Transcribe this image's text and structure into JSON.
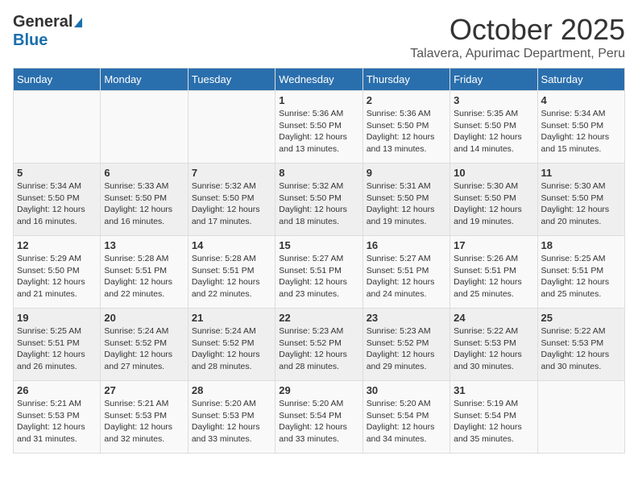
{
  "logo": {
    "general": "General",
    "blue": "Blue"
  },
  "header": {
    "month": "October 2025",
    "location": "Talavera, Apurimac Department, Peru"
  },
  "weekdays": [
    "Sunday",
    "Monday",
    "Tuesday",
    "Wednesday",
    "Thursday",
    "Friday",
    "Saturday"
  ],
  "weeks": [
    [
      {
        "day": "",
        "info": ""
      },
      {
        "day": "",
        "info": ""
      },
      {
        "day": "",
        "info": ""
      },
      {
        "day": "1",
        "info": "Sunrise: 5:36 AM\nSunset: 5:50 PM\nDaylight: 12 hours\nand 13 minutes."
      },
      {
        "day": "2",
        "info": "Sunrise: 5:36 AM\nSunset: 5:50 PM\nDaylight: 12 hours\nand 13 minutes."
      },
      {
        "day": "3",
        "info": "Sunrise: 5:35 AM\nSunset: 5:50 PM\nDaylight: 12 hours\nand 14 minutes."
      },
      {
        "day": "4",
        "info": "Sunrise: 5:34 AM\nSunset: 5:50 PM\nDaylight: 12 hours\nand 15 minutes."
      }
    ],
    [
      {
        "day": "5",
        "info": "Sunrise: 5:34 AM\nSunset: 5:50 PM\nDaylight: 12 hours\nand 16 minutes."
      },
      {
        "day": "6",
        "info": "Sunrise: 5:33 AM\nSunset: 5:50 PM\nDaylight: 12 hours\nand 16 minutes."
      },
      {
        "day": "7",
        "info": "Sunrise: 5:32 AM\nSunset: 5:50 PM\nDaylight: 12 hours\nand 17 minutes."
      },
      {
        "day": "8",
        "info": "Sunrise: 5:32 AM\nSunset: 5:50 PM\nDaylight: 12 hours\nand 18 minutes."
      },
      {
        "day": "9",
        "info": "Sunrise: 5:31 AM\nSunset: 5:50 PM\nDaylight: 12 hours\nand 19 minutes."
      },
      {
        "day": "10",
        "info": "Sunrise: 5:30 AM\nSunset: 5:50 PM\nDaylight: 12 hours\nand 19 minutes."
      },
      {
        "day": "11",
        "info": "Sunrise: 5:30 AM\nSunset: 5:50 PM\nDaylight: 12 hours\nand 20 minutes."
      }
    ],
    [
      {
        "day": "12",
        "info": "Sunrise: 5:29 AM\nSunset: 5:50 PM\nDaylight: 12 hours\nand 21 minutes."
      },
      {
        "day": "13",
        "info": "Sunrise: 5:28 AM\nSunset: 5:51 PM\nDaylight: 12 hours\nand 22 minutes."
      },
      {
        "day": "14",
        "info": "Sunrise: 5:28 AM\nSunset: 5:51 PM\nDaylight: 12 hours\nand 22 minutes."
      },
      {
        "day": "15",
        "info": "Sunrise: 5:27 AM\nSunset: 5:51 PM\nDaylight: 12 hours\nand 23 minutes."
      },
      {
        "day": "16",
        "info": "Sunrise: 5:27 AM\nSunset: 5:51 PM\nDaylight: 12 hours\nand 24 minutes."
      },
      {
        "day": "17",
        "info": "Sunrise: 5:26 AM\nSunset: 5:51 PM\nDaylight: 12 hours\nand 25 minutes."
      },
      {
        "day": "18",
        "info": "Sunrise: 5:25 AM\nSunset: 5:51 PM\nDaylight: 12 hours\nand 25 minutes."
      }
    ],
    [
      {
        "day": "19",
        "info": "Sunrise: 5:25 AM\nSunset: 5:51 PM\nDaylight: 12 hours\nand 26 minutes."
      },
      {
        "day": "20",
        "info": "Sunrise: 5:24 AM\nSunset: 5:52 PM\nDaylight: 12 hours\nand 27 minutes."
      },
      {
        "day": "21",
        "info": "Sunrise: 5:24 AM\nSunset: 5:52 PM\nDaylight: 12 hours\nand 28 minutes."
      },
      {
        "day": "22",
        "info": "Sunrise: 5:23 AM\nSunset: 5:52 PM\nDaylight: 12 hours\nand 28 minutes."
      },
      {
        "day": "23",
        "info": "Sunrise: 5:23 AM\nSunset: 5:52 PM\nDaylight: 12 hours\nand 29 minutes."
      },
      {
        "day": "24",
        "info": "Sunrise: 5:22 AM\nSunset: 5:53 PM\nDaylight: 12 hours\nand 30 minutes."
      },
      {
        "day": "25",
        "info": "Sunrise: 5:22 AM\nSunset: 5:53 PM\nDaylight: 12 hours\nand 30 minutes."
      }
    ],
    [
      {
        "day": "26",
        "info": "Sunrise: 5:21 AM\nSunset: 5:53 PM\nDaylight: 12 hours\nand 31 minutes."
      },
      {
        "day": "27",
        "info": "Sunrise: 5:21 AM\nSunset: 5:53 PM\nDaylight: 12 hours\nand 32 minutes."
      },
      {
        "day": "28",
        "info": "Sunrise: 5:20 AM\nSunset: 5:53 PM\nDaylight: 12 hours\nand 33 minutes."
      },
      {
        "day": "29",
        "info": "Sunrise: 5:20 AM\nSunset: 5:54 PM\nDaylight: 12 hours\nand 33 minutes."
      },
      {
        "day": "30",
        "info": "Sunrise: 5:20 AM\nSunset: 5:54 PM\nDaylight: 12 hours\nand 34 minutes."
      },
      {
        "day": "31",
        "info": "Sunrise: 5:19 AM\nSunset: 5:54 PM\nDaylight: 12 hours\nand 35 minutes."
      },
      {
        "day": "",
        "info": ""
      }
    ]
  ]
}
